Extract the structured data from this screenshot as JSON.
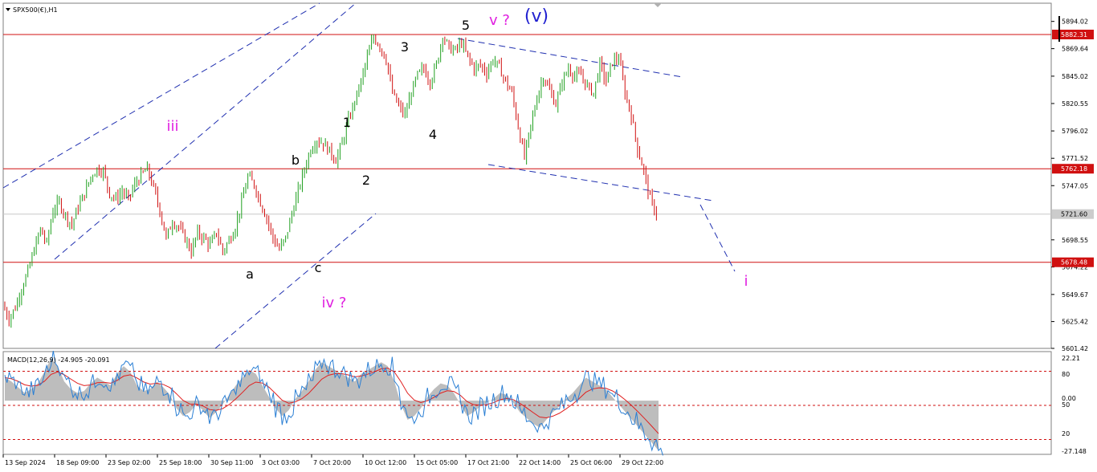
{
  "chart_data": [
    {
      "type": "candlestick",
      "title": "SPX500(€),H1",
      "ylim": [
        5601.42,
        5906.0
      ],
      "y_ticks": [
        "5894.02",
        "5869.64",
        "5845.02",
        "5820.55",
        "5796.02",
        "5771.52",
        "5747.05",
        "5698.55",
        "5674.22",
        "5649.67",
        "5625.42",
        "5601.42"
      ],
      "price_labels": [
        {
          "text": "5882.31",
          "value": 5882.31,
          "color": "#d01010"
        },
        {
          "text": "5762.18",
          "value": 5762.18,
          "color": "#d01010"
        },
        {
          "text": "5721.60",
          "value": 5721.6,
          "color": "#cccccc"
        },
        {
          "text": "5678.48",
          "value": 5678.48,
          "color": "#d01010"
        }
      ],
      "horizontal_lines": [
        {
          "value": 5882.31,
          "color": "#d01010"
        },
        {
          "value": 5762.18,
          "color": "#d01010"
        },
        {
          "value": 5721.6,
          "color": "#c8c8c8"
        },
        {
          "value": 5678.48,
          "color": "#d01010"
        }
      ],
      "x_ticks": [
        "13 Sep 2024",
        "18 Sep 09:00",
        "23 Sep 02:00",
        "25 Sep 18:00",
        "30 Sep 11:00",
        "3 Oct 03:00",
        "7 Oct 20:00",
        "10 Oct 12:00",
        "15 Oct 05:00",
        "17 Oct 21:00",
        "22 Oct 14:00",
        "25 Oct 06:00",
        "29 Oct 22:00"
      ],
      "price_path": [
        5640,
        5628,
        5638,
        5655,
        5670,
        5690,
        5708,
        5695,
        5725,
        5732,
        5720,
        5712,
        5728,
        5740,
        5755,
        5762,
        5760,
        5740,
        5735,
        5742,
        5735,
        5748,
        5756,
        5762,
        5745,
        5725,
        5700,
        5715,
        5710,
        5700,
        5688,
        5705,
        5700,
        5694,
        5705,
        5688,
        5698,
        5710,
        5732,
        5755,
        5748,
        5732,
        5718,
        5700,
        5690,
        5700,
        5722,
        5742,
        5762,
        5780,
        5788,
        5785,
        5778,
        5770,
        5785,
        5805,
        5823,
        5840,
        5862,
        5880,
        5872,
        5860,
        5830,
        5818,
        5810,
        5830,
        5846,
        5852,
        5840,
        5855,
        5882,
        5870,
        5868,
        5875,
        5862,
        5852,
        5855,
        5848,
        5860,
        5853,
        5840,
        5830,
        5800,
        5772,
        5800,
        5826,
        5845,
        5832,
        5820,
        5840,
        5852,
        5845,
        5846,
        5836,
        5830,
        5856,
        5840,
        5858,
        5862,
        5830,
        5810,
        5780,
        5760,
        5735,
        5722
      ],
      "annotations": [
        {
          "text": "iii",
          "color": "#e020e0"
        },
        {
          "text": "b",
          "color": "#000000"
        },
        {
          "text": "1",
          "color": "#000000"
        },
        {
          "text": "2",
          "color": "#000000"
        },
        {
          "text": "3",
          "color": "#000000"
        },
        {
          "text": "4",
          "color": "#000000"
        },
        {
          "text": "5",
          "color": "#000000"
        },
        {
          "text": "v ?",
          "color": "#e020e0"
        },
        {
          "text": "(v)",
          "color": "#2020d0"
        },
        {
          "text": "a",
          "color": "#000000"
        },
        {
          "text": "c",
          "color": "#000000"
        },
        {
          "text": "iv ?",
          "color": "#e020e0"
        },
        {
          "text": "i",
          "color": "#e020e0"
        }
      ],
      "colors": {
        "up": "#20a020",
        "down": "#d01010",
        "channel": "#2030b0",
        "level": "#d01010"
      }
    },
    {
      "type": "line",
      "title": "MACD(12,26,9) -24.905 -20.091",
      "ylim": [
        -27.148,
        22.21
      ],
      "y_ticks": [
        "22.21",
        "80",
        "0.00",
        "50",
        "20",
        "-27.148"
      ],
      "series": [
        {
          "values": [
            12,
            10,
            7,
            4,
            6,
            9,
            15,
            22,
            18,
            10,
            6,
            4,
            5,
            9,
            12,
            10,
            8,
            14,
            18,
            15,
            8,
            5,
            6,
            10,
            7,
            3,
            -4,
            -8,
            -6,
            -2,
            -5,
            -9,
            -6,
            -2,
            3,
            8,
            12,
            16,
            14,
            8,
            2,
            -4,
            -8,
            -5,
            1,
            5,
            10,
            16,
            20,
            18,
            16,
            14,
            12,
            10,
            14,
            16,
            18,
            20,
            18,
            10,
            -2,
            -10,
            -8,
            -4,
            2,
            6,
            9,
            8,
            4,
            -2,
            -8,
            -6,
            -3,
            -1,
            1,
            4,
            3,
            -1,
            -6,
            -9,
            -12,
            -14,
            -10,
            -6,
            -3,
            1,
            4,
            8,
            12,
            10,
            8,
            6,
            2,
            -2,
            -6,
            -10,
            -14,
            -18,
            -22,
            -26
          ]
        }
      ]
    }
  ]
}
